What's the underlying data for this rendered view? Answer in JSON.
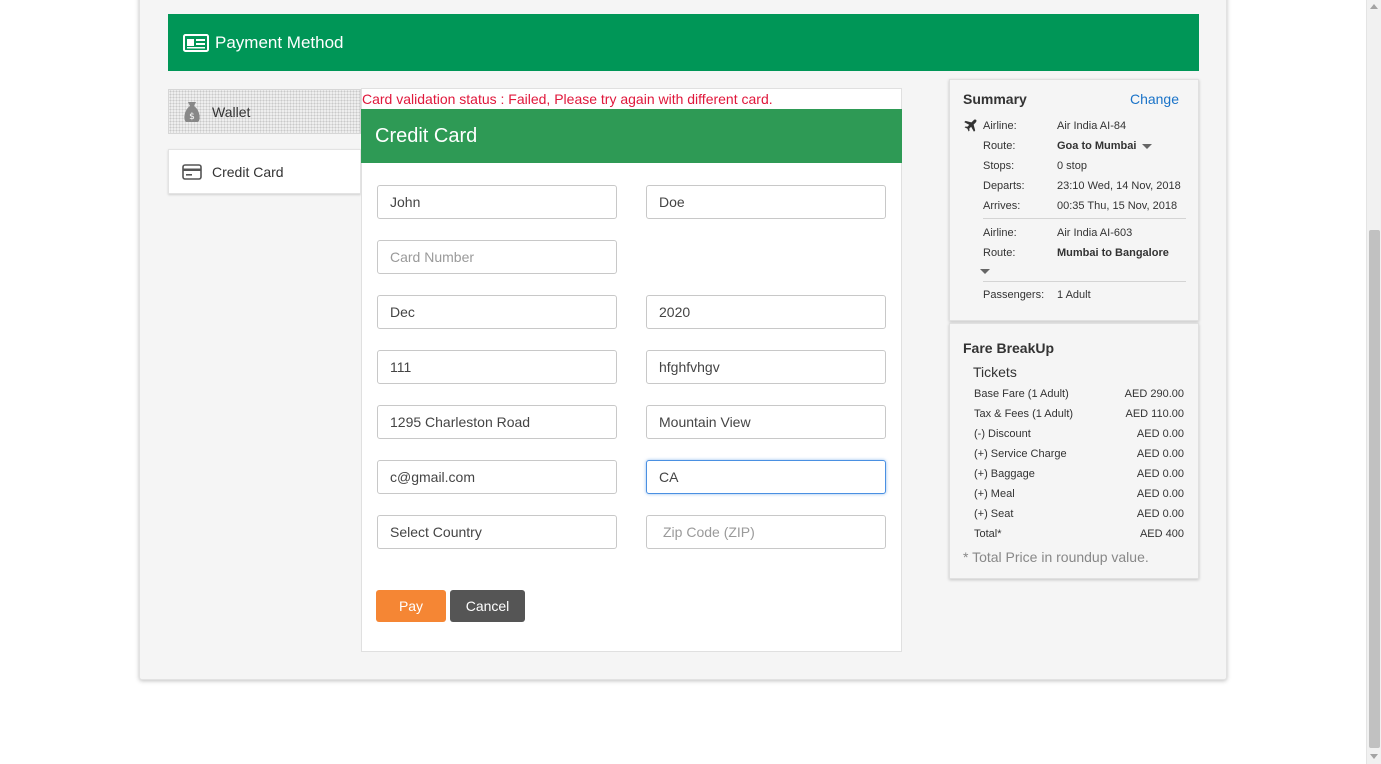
{
  "header": {
    "title": "Payment Method",
    "icon": "card-id-icon"
  },
  "tabs": [
    {
      "label": "Wallet",
      "icon": "money-bag-icon"
    },
    {
      "label": "Credit Card",
      "icon": "credit-card-icon"
    }
  ],
  "error_message": "Card validation status : Failed, Please try again with different card.",
  "credit_card": {
    "title": "Credit Card",
    "first_name": "John",
    "last_name": "Doe",
    "card_number_placeholder": "Card Number",
    "expiry_month": "Dec",
    "expiry_year": "2020",
    "cvv": "111",
    "name_on_card": "hfghfvhgv",
    "address": "1295 Charleston Road",
    "city": "Mountain View",
    "email": "c@gmail.com",
    "state": "CA",
    "country": "Select Country",
    "zip_placeholder": "Zip Code (ZIP)",
    "pay_label": "Pay",
    "cancel_label": "Cancel"
  },
  "summary": {
    "title": "Summary",
    "change_label": "Change",
    "flight1": {
      "airline_label": "Airline:",
      "airline": "Air India AI-84",
      "route_label": "Route:",
      "route": "Goa to Mumbai",
      "stops_label": "Stops:",
      "stops": "0 stop",
      "departs_label": "Departs:",
      "departs": "23:10 Wed, 14 Nov, 2018",
      "arrives_label": "Arrives:",
      "arrives": "00:35 Thu, 15 Nov, 2018"
    },
    "flight2": {
      "airline_label": "Airline:",
      "airline": "Air India AI-603",
      "route_label": "Route:",
      "route": "Mumbai to Bangalore"
    },
    "passengers_label": "Passengers:",
    "passengers": "1 Adult"
  },
  "fare": {
    "title": "Fare BreakUp",
    "subtitle": "Tickets",
    "rows": [
      {
        "label": "Base Fare (1 Adult)",
        "value": "AED 290.00"
      },
      {
        "label": "Tax & Fees (1 Adult)",
        "value": "AED 110.00"
      },
      {
        "label": "(-) Discount",
        "value": "AED 0.00"
      },
      {
        "label": "(+) Service Charge",
        "value": "AED 0.00"
      },
      {
        "label": "(+) Baggage",
        "value": "AED 0.00"
      },
      {
        "label": "(+) Meal",
        "value": "AED 0.00"
      },
      {
        "label": "(+) Seat",
        "value": "AED 0.00"
      },
      {
        "label": "Total*",
        "value": "AED 400"
      }
    ],
    "note": "* Total Price in roundup value."
  },
  "colors": {
    "header_green": "#009657",
    "card_header_green": "#2e9a55",
    "error_red": "#e0173b",
    "pay_orange": "#f58634",
    "cancel_gray": "#555555",
    "link_blue": "#1a73c8"
  }
}
